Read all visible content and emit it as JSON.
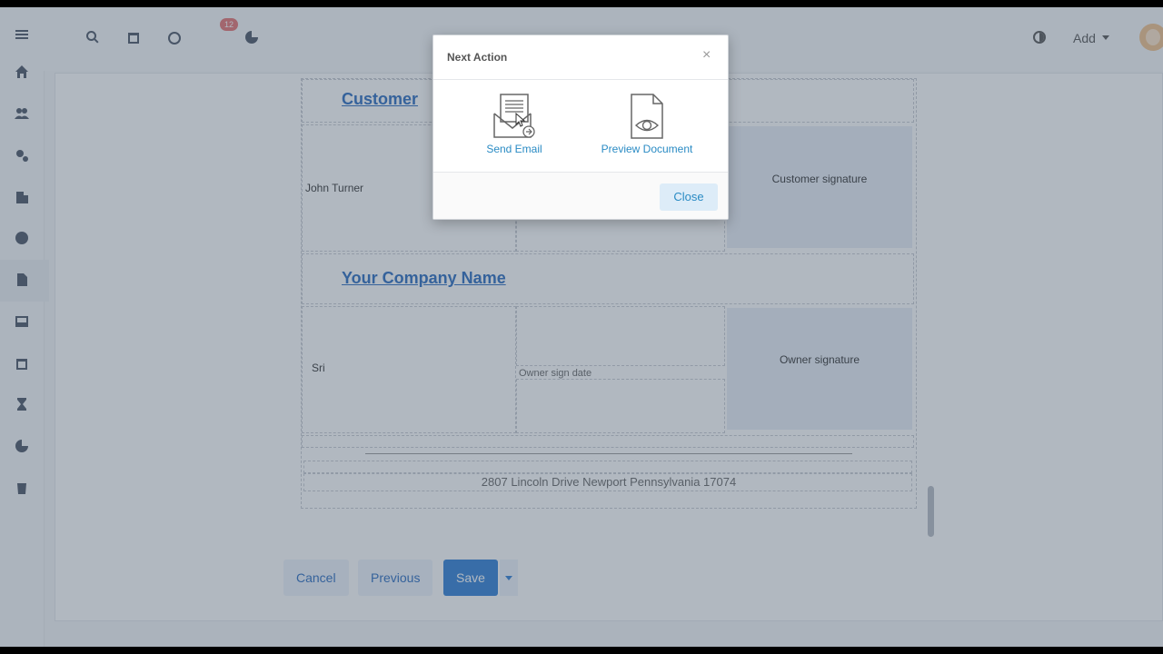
{
  "topbar": {
    "badge_count": "12",
    "add_label": "Add"
  },
  "sidebar": {
    "items": [
      "menu-icon",
      "home-icon",
      "users-icon",
      "settings-icon",
      "building-icon",
      "dollar-icon",
      "document-icon",
      "inbox-icon",
      "calendar-icon",
      "hourglass-icon",
      "chart-icon",
      "trash-icon"
    ]
  },
  "document": {
    "customer_heading": "Customer",
    "customer_name": "John Turner",
    "customer_signature_label": "Customer signature",
    "company_heading": "Your Company Name",
    "owner_name": "Sri",
    "owner_sign_date_label": "Owner sign date",
    "owner_signature_label": "Owner signature",
    "address": "2807 Lincoln Drive Newport Pennsylvania 17074"
  },
  "actions": {
    "cancel_label": "Cancel",
    "previous_label": "Previous",
    "save_label": "Save"
  },
  "modal": {
    "title": "Next Action",
    "close_x": "×",
    "send_email_label": "Send Email",
    "preview_label": "Preview Document",
    "close_button_label": "Close"
  },
  "colors": {
    "accent": "#2a8bc4",
    "primary_button": "#2f7fd6",
    "badge": "#e57373"
  }
}
